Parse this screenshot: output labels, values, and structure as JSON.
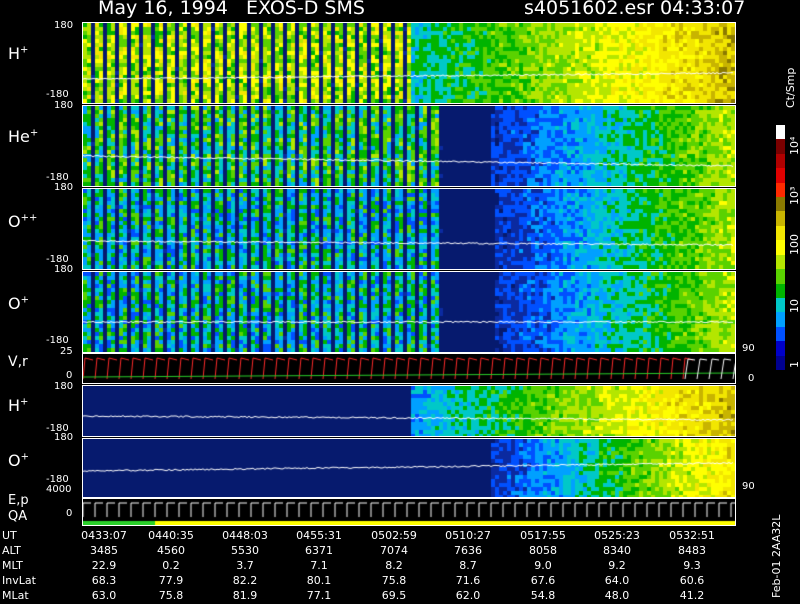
{
  "header": {
    "title": "May 16, 1994   EXOS-D SMS",
    "file": "s4051602.esr",
    "time": "04:33:07"
  },
  "panels": [
    {
      "id": "h-plus",
      "label": "H+",
      "label_base": "H",
      "label_sup": "+",
      "top_tick": "180",
      "bottom_tick": "-180"
    },
    {
      "id": "he-plus",
      "label": "He+",
      "label_base": "He",
      "label_sup": "+",
      "top_tick": "180",
      "bottom_tick": "-180"
    },
    {
      "id": "o-plusplus",
      "label": "O++",
      "label_base": "O",
      "label_sup": "++",
      "top_tick": "180",
      "bottom_tick": "-180"
    },
    {
      "id": "o-plus",
      "label": "O+",
      "label_base": "O",
      "label_sup": "+",
      "top_tick": "180",
      "bottom_tick": "-180"
    },
    {
      "id": "vr",
      "label": "V,r",
      "top_tick": "25",
      "bottom_tick": "0",
      "right_tick": "90",
      "right_tick2": "0"
    },
    {
      "id": "h-plus-2",
      "label": "H+",
      "label_base": "H",
      "label_sup": "+",
      "top_tick": "180",
      "bottom_tick": "-180"
    },
    {
      "id": "o-plus-2",
      "label": "O+",
      "label_base": "O",
      "label_sup": "+",
      "top_tick": "180",
      "bottom_tick": "-180",
      "right_tick": "90"
    },
    {
      "id": "ep-qa",
      "label": "E,p",
      "label2": "QA",
      "top_tick": "4000",
      "bottom_tick": "0"
    }
  ],
  "colorbar": {
    "unit": "Ct/Smp",
    "ticks": [
      "10⁴",
      "10³",
      "100",
      "10",
      "1"
    ],
    "colors": [
      "#ffffff",
      "#7a0000",
      "#b00000",
      "#e00000",
      "#ff2a00",
      "#8b7a00",
      "#c8b400",
      "#f2e600",
      "#ffff00",
      "#b4e600",
      "#5ad200",
      "#00b400",
      "#00c8c8",
      "#00a0ff",
      "#0050ff",
      "#0000c8",
      "#000090"
    ]
  },
  "axis_table": {
    "rows": [
      {
        "label": "UT",
        "values": [
          "0433:07",
          "0440:35",
          "0448:03",
          "0455:31",
          "0502:59",
          "0510:27",
          "0517:55",
          "0525:23",
          "0532:51"
        ]
      },
      {
        "label": "ALT",
        "values": [
          "3485",
          "4560",
          "5530",
          "6371",
          "7074",
          "7636",
          "8058",
          "8340",
          "8483"
        ]
      },
      {
        "label": "MLT",
        "values": [
          "22.9",
          "0.2",
          "3.7",
          "7.1",
          "8.2",
          "8.7",
          "9.0",
          "9.2",
          "9.3"
        ]
      },
      {
        "label": "InvLat",
        "values": [
          "68.3",
          "77.9",
          "82.2",
          "80.1",
          "75.8",
          "71.6",
          "67.6",
          "64.0",
          "60.6"
        ]
      },
      {
        "label": "MLat",
        "values": [
          "63.0",
          "75.8",
          "81.9",
          "77.1",
          "69.5",
          "62.0",
          "54.8",
          "48.0",
          "41.2"
        ]
      }
    ]
  },
  "footer_vertical": "Feb-01 2AA32L",
  "chart_data": {
    "type": "heatmap",
    "title": "May 16, 1994   EXOS-D SMS",
    "x": [
      "0433:07",
      "0440:35",
      "0448:03",
      "0455:31",
      "0502:59",
      "0510:27",
      "0517:55",
      "0525:23",
      "0532:51"
    ],
    "y_range": [
      -180,
      180
    ],
    "series": [
      {
        "name": "H+"
      },
      {
        "name": "He+"
      },
      {
        "name": "O++"
      },
      {
        "name": "O+"
      },
      {
        "name": "V,r"
      },
      {
        "name": "H+"
      },
      {
        "name": "O+"
      },
      {
        "name": "E,p"
      }
    ],
    "colorbar_label": "Ct/Smp",
    "colorbar_ticks": [
      "1",
      "10",
      "100",
      "10³",
      "10⁴"
    ]
  }
}
